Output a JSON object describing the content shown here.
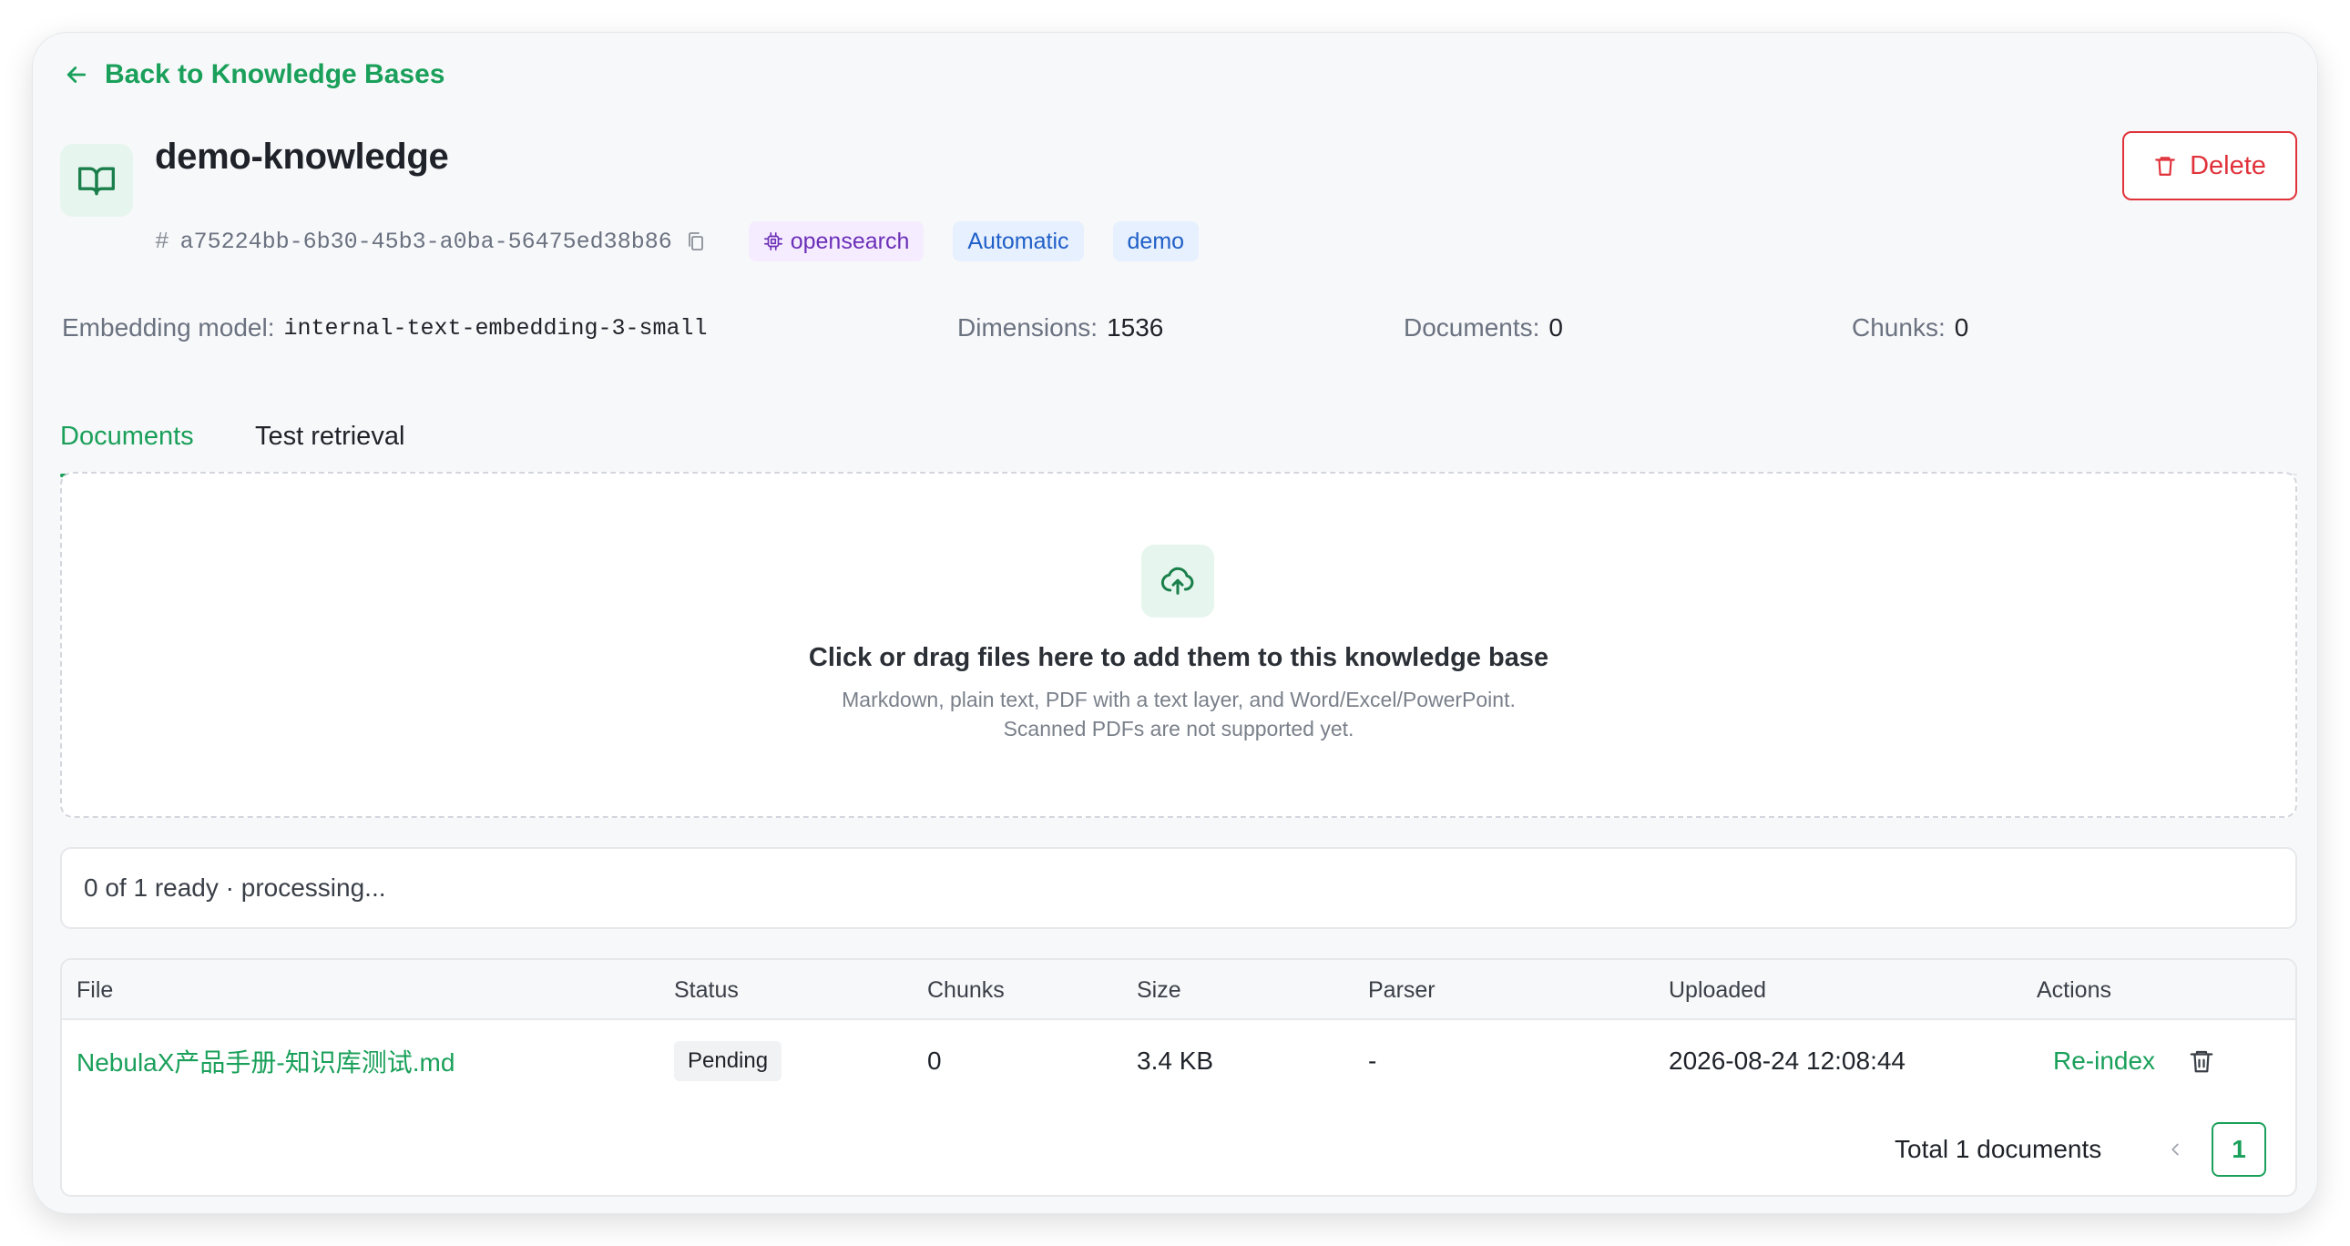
{
  "nav": {
    "back_label": "Back to Knowledge Bases"
  },
  "kb": {
    "name": "demo-knowledge",
    "id_prefix": "#",
    "id": "a75224bb-6b30-45b3-a0ba-56475ed38b86",
    "engine_tag": "opensearch",
    "mode_tag": "Automatic",
    "label_tag": "demo",
    "delete_label": "Delete"
  },
  "stats": {
    "embedding_label": "Embedding model:",
    "embedding_value": "internal-text-embedding-3-small",
    "dimensions_label": "Dimensions:",
    "dimensions_value": "1536",
    "documents_label": "Documents:",
    "documents_value": "0",
    "chunks_label": "Chunks:",
    "chunks_value": "0"
  },
  "tabs": [
    {
      "label": "Documents",
      "active": true
    },
    {
      "label": "Test retrieval",
      "active": false
    }
  ],
  "dropzone": {
    "title": "Click or drag files here to add them to this knowledge base",
    "subtitle_line1": "Markdown, plain text, PDF with a text layer, and Word/Excel/PowerPoint.",
    "subtitle_line2": "Scanned PDFs are not supported yet."
  },
  "progress": {
    "text": "0 of 1 ready · processing..."
  },
  "table": {
    "columns": [
      "File",
      "Status",
      "Chunks",
      "Size",
      "Parser",
      "Uploaded",
      "Actions"
    ],
    "rows": [
      {
        "file": "NebulaX产品手册-知识库测试.md",
        "status": "Pending",
        "chunks": "0",
        "size": "3.4 KB",
        "parser": "-",
        "uploaded": "2026-08-24 12:08:44",
        "action": "Re-index"
      }
    ]
  },
  "pagination": {
    "total_text": "Total 1 documents",
    "current_page": "1"
  },
  "colors": {
    "accent": "#1aa05a",
    "danger": "#e0323a",
    "engine_tag_bg": "#f6ecff",
    "engine_tag_text": "#6b2fb8",
    "tag_bg": "#e7f0fe",
    "tag_text": "#1f5fc8"
  },
  "icons": {
    "back": "arrow-left-icon",
    "kb": "book-open-icon",
    "copy": "copy-icon",
    "engine": "chip-icon",
    "delete": "trash-icon",
    "upload": "cloud-upload-icon",
    "row_delete": "trash-icon",
    "prev": "chevron-left-icon",
    "next": "chevron-right-icon"
  }
}
